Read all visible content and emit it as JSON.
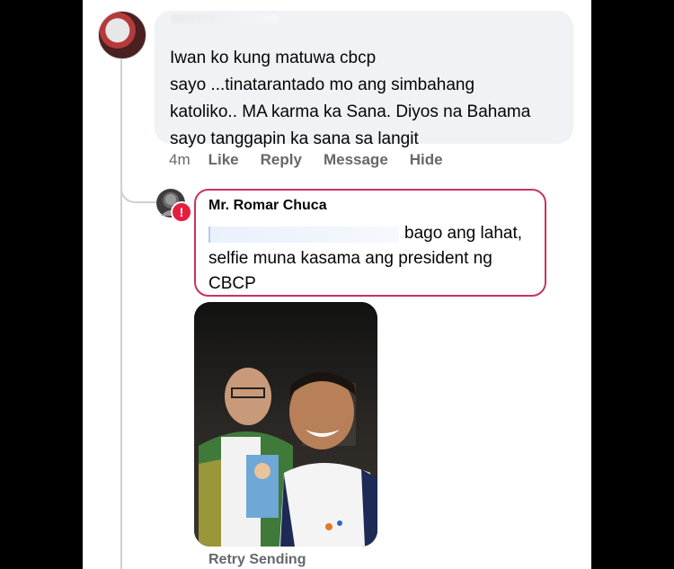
{
  "top_comment": {
    "text": "Iwan ko kung matuwa cbcp\nsayo ...tinatarantado mo ang simbahang\nkatoliko.. MA karma ka Sana. Diyos na Bahama\nsayo tanggapin ka sana sa langit",
    "time": "4m",
    "actions": [
      "Like",
      "Reply",
      "Message",
      "Hide"
    ]
  },
  "reply": {
    "author": "Mr. Romar Chuca",
    "line1": "bago ang lahat,",
    "line2": "selfie muna kasama ang president ng CBCP",
    "status": "Retry Sending"
  },
  "icons": {
    "error": "!",
    "error_color": "#e41e3f",
    "accent_border": "#c7345e"
  }
}
